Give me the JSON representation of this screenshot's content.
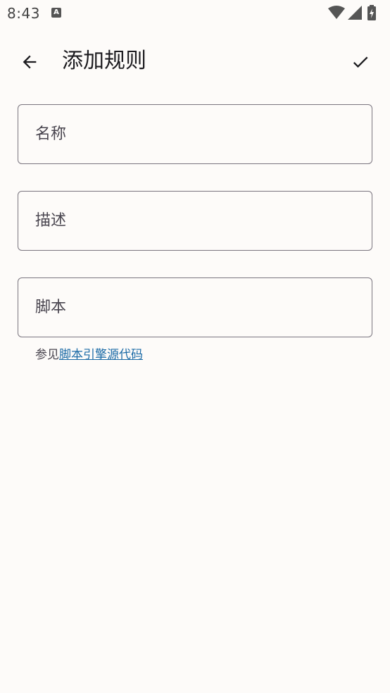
{
  "status_bar": {
    "time": "8:43",
    "app_icon_letter": "A"
  },
  "app_bar": {
    "title": "添加规则"
  },
  "form": {
    "name_placeholder": "名称",
    "description_placeholder": "描述",
    "script_placeholder": "脚本",
    "helper_prefix": "参见",
    "helper_link": "脚本引擎源代码"
  },
  "icons": {
    "back": "arrow-back-icon",
    "confirm": "check-icon",
    "wifi": "wifi-icon",
    "signal": "signal-icon",
    "battery": "battery-charging-icon"
  },
  "colors": {
    "background": "#fdfbf9",
    "outline": "#79747e",
    "link": "#1a6aa6"
  }
}
